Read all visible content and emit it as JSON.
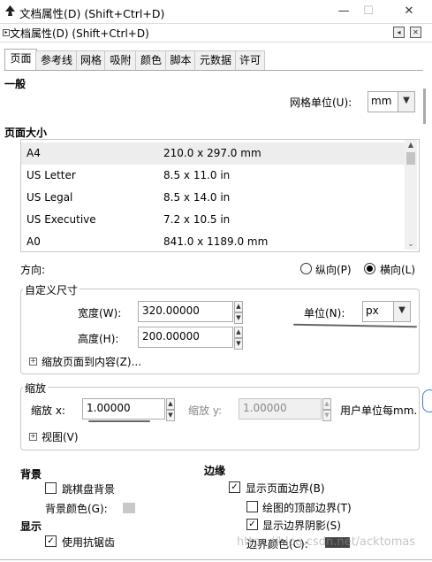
{
  "window": {
    "title": "文档属性(D) (Shift+Ctrl+D)",
    "minimize": "—",
    "maximize": "☐",
    "close": "✕"
  },
  "dock": {
    "title": "文档属性(D) (Shift+Ctrl+D)",
    "btn1": "◂",
    "btn2": "✕"
  },
  "tabs": [
    "页面",
    "参考线",
    "网格",
    "吸附",
    "颜色",
    "脚本",
    "元数据",
    "许可"
  ],
  "general": {
    "heading": "一般",
    "grid_unit_label": "网格单位(U):",
    "grid_unit_value": "mm"
  },
  "page_size": {
    "heading": "页面大小",
    "rows": [
      {
        "name": "A4",
        "size": "210.0 x 297.0 mm",
        "selected": true
      },
      {
        "name": "US Letter",
        "size": "8.5 x 11.0 in"
      },
      {
        "name": "US Legal",
        "size": "8.5 x 14.0 in"
      },
      {
        "name": "US Executive",
        "size": "7.2 x 10.5 in"
      },
      {
        "name": "A0",
        "size": "841.0 x 1189.0 mm"
      }
    ]
  },
  "orientation": {
    "label": "方向:",
    "portrait": "纵向(P)",
    "landscape": "横向(L)",
    "selected": "landscape"
  },
  "custom_size": {
    "legend": "自定义尺寸",
    "width_label": "宽度(W):",
    "width_value": "320.00000",
    "height_label": "高度(H):",
    "height_value": "200.00000",
    "unit_label": "单位(N):",
    "unit_value": "px",
    "resize_label": "缩放页面到内容(Z)..."
  },
  "scale": {
    "legend": "缩放",
    "scale_x_label": "缩放 x:",
    "scale_x_value": "1.00000",
    "scale_y_label": "缩放 y:",
    "scale_y_value": "1.00000",
    "user_units": "用户单位每mm.",
    "viewbox_label": "视图(V)"
  },
  "background": {
    "heading": "背景",
    "checkerboard_label": "跳棋盘背景",
    "checkerboard_checked": false,
    "bg_color_label": "背景颜色(G):",
    "bg_color": "#c8c8c8"
  },
  "display": {
    "heading": "显示",
    "antialias_label": "使用抗锯齿",
    "antialias_checked": true
  },
  "border": {
    "heading": "边缘",
    "show_border_label": "显示页面边界(B)",
    "show_border_checked": true,
    "on_top_label": "绘图的顶部边界(T)",
    "on_top_checked": false,
    "shadow_label": "显示边界阴影(S)",
    "shadow_checked": true,
    "border_color_label": "边界颜色(C):",
    "border_color": "#444444"
  },
  "watermark": "https://blog.csdn.net/acktomas"
}
